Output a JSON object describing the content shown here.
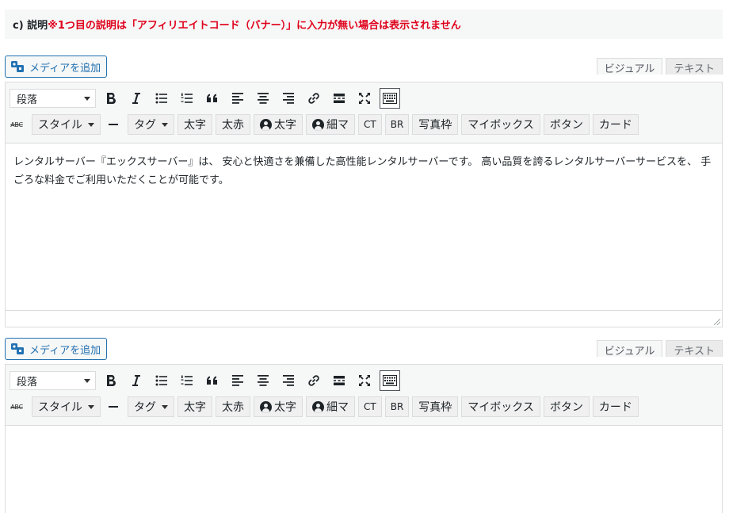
{
  "notice": {
    "label": "c) 説明",
    "warning": "※1つ目の説明は「アフィリエイトコード（バナー）」に入力が無い場合は表示されません"
  },
  "editors": [
    {
      "media_button": "メディアを追加",
      "tab_visual": "ビジュアル",
      "tab_text": "テキスト",
      "format_select": "段落",
      "buttons": {
        "style": "スタイル",
        "tag": "タグ",
        "bold_jp": "太字",
        "bold_red": "太赤",
        "user_bold": "太字",
        "user_thin": "細マ",
        "ct": "CT",
        "br": "BR",
        "photo_frame": "写真枠",
        "mybox": "マイボックス",
        "button": "ボタン",
        "card": "カード"
      },
      "content": "レンタルサーバー『エックスサーバー』は、 安心と快適さを兼備した高性能レンタルサーバーです。 高い品質を誇るレンタルサーバーサービスを、 手ごろな料金でご利用いただくことが可能です。"
    },
    {
      "media_button": "メディアを追加",
      "tab_visual": "ビジュアル",
      "tab_text": "テキスト",
      "format_select": "段落",
      "buttons": {
        "style": "スタイル",
        "tag": "タグ",
        "bold_jp": "太字",
        "bold_red": "太赤",
        "user_bold": "太字",
        "user_thin": "細マ",
        "ct": "CT",
        "br": "BR",
        "photo_frame": "写真枠",
        "mybox": "マイボックス",
        "button": "ボタン",
        "card": "カード"
      },
      "content": ""
    }
  ],
  "icons": {
    "strikethrough_label": "ABC"
  },
  "colors": {
    "accent": "#2271b1",
    "warning": "#e0001b"
  }
}
